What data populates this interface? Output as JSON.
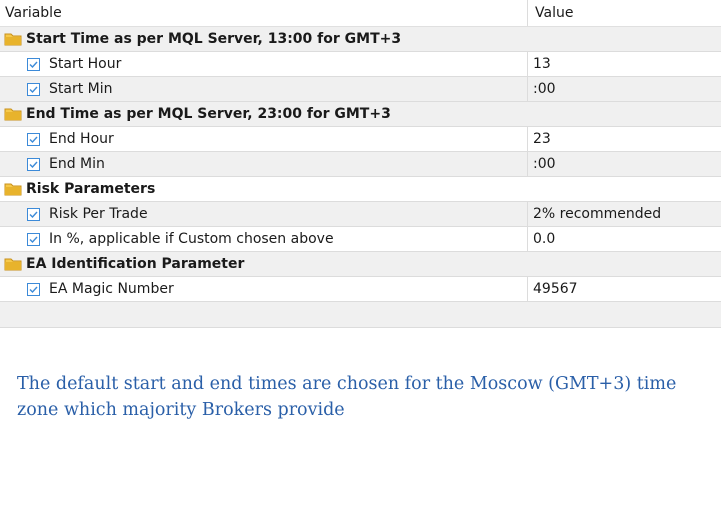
{
  "header": {
    "col_variable": "Variable",
    "col_value": "Value"
  },
  "rows": [
    {
      "type": "group",
      "label": "Start Time as per MQL Server, 13:00 for GMT+3"
    },
    {
      "type": "param",
      "label": "Start Hour",
      "value": "13"
    },
    {
      "type": "param",
      "label": "Start Min",
      "value": ":00"
    },
    {
      "type": "group",
      "label": "End Time as per MQL Server, 23:00 for GMT+3"
    },
    {
      "type": "param",
      "label": "End Hour",
      "value": "23"
    },
    {
      "type": "param",
      "label": "End Min",
      "value": ":00"
    },
    {
      "type": "group",
      "label": "Risk Parameters"
    },
    {
      "type": "param",
      "label": "Risk Per Trade",
      "value": "2% recommended"
    },
    {
      "type": "param",
      "label": "In %, applicable if Custom chosen above",
      "value": "0.0"
    },
    {
      "type": "group",
      "label": "EA Identification Parameter"
    },
    {
      "type": "param",
      "label": "EA Magic Number",
      "value": "49567"
    }
  ],
  "note": "The default start and end times are chosen for the Moscow (GMT+3) time zone which majority Brokers provide",
  "colors": {
    "folder": "#e8b32c",
    "checkbox": "#3c8ad8",
    "note": "#2a5fa8"
  }
}
